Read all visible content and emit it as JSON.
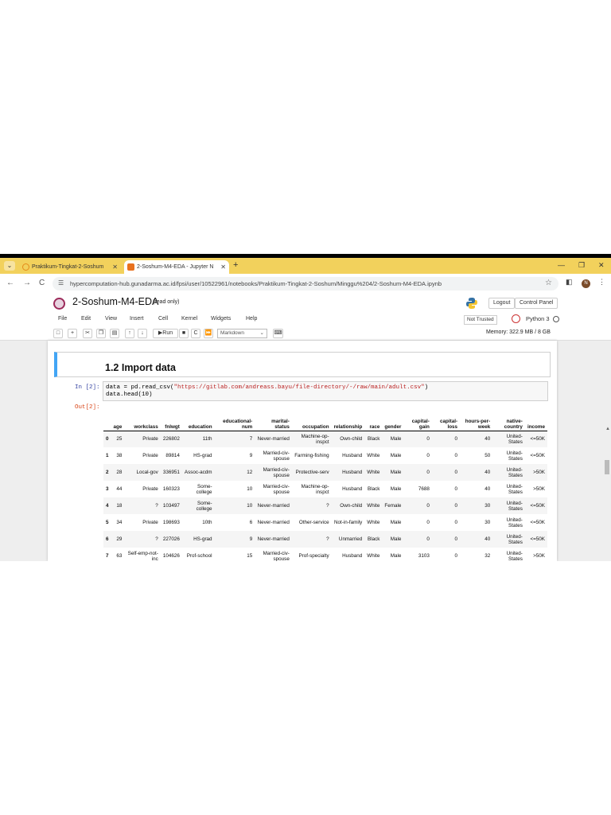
{
  "browser": {
    "tabs": [
      {
        "title": "Praktikum-Tingkat-2-Soshum",
        "active": false
      },
      {
        "title": "2-Soshum-M4-EDA - Jupyter N",
        "active": true
      }
    ],
    "url": "hypercomputation-hub.gunadarma.ac.id/fpsi/user/10522961/notebooks/Praktikum-Tingkat-2-Soshum/Minggu%204/2-Soshum-M4-EDA.ipynb",
    "avatar_letter": "N"
  },
  "jupyter": {
    "notebook_name": "2-Soshum-M4-EDA",
    "save_status": "(read only)",
    "logout_label": "Logout",
    "control_panel_label": "Control Panel",
    "menu": [
      "File",
      "Edit",
      "View",
      "Insert",
      "Cell",
      "Kernel",
      "Widgets",
      "Help"
    ],
    "trust_label": "Not Trusted",
    "kernel_name": "Python 3",
    "run_label": "Run",
    "cell_type": "Markdown",
    "memory": "Memory: 322.9 MB / 8 GB"
  },
  "cells": {
    "heading": "1.2 Import data",
    "in_prompt": "In [2]:",
    "out_prompt": "Out[2]:",
    "code_line1_pre": "data = pd.read_csv(",
    "code_line1_str": "\"https://gitlab.com/andreass.bayu/file-directory/-/raw/main/adult.csv\"",
    "code_line1_post": ")",
    "code_line2": "data.head(10)"
  },
  "table": {
    "columns": [
      "",
      "age",
      "workclass",
      "fnlwgt",
      "education",
      "educational-num",
      "marital-status",
      "occupation",
      "relationship",
      "race",
      "gender",
      "capital-gain",
      "capital-loss",
      "hours-per-week",
      "native-country",
      "income"
    ],
    "rows": [
      [
        "0",
        "25",
        "Private",
        "226802",
        "11th",
        "7",
        "Never-married",
        "Machine-op-inspct",
        "Own-child",
        "Black",
        "Male",
        "0",
        "0",
        "40",
        "United-States",
        "<=50K"
      ],
      [
        "1",
        "38",
        "Private",
        "89814",
        "HS-grad",
        "9",
        "Married-civ-spouse",
        "Farming-fishing",
        "Husband",
        "White",
        "Male",
        "0",
        "0",
        "50",
        "United-States",
        "<=50K"
      ],
      [
        "2",
        "28",
        "Local-gov",
        "336951",
        "Assoc-acdm",
        "12",
        "Married-civ-spouse",
        "Protective-serv",
        "Husband",
        "White",
        "Male",
        "0",
        "0",
        "40",
        "United-States",
        ">50K"
      ],
      [
        "3",
        "44",
        "Private",
        "160323",
        "Some-college",
        "10",
        "Married-civ-spouse",
        "Machine-op-inspct",
        "Husband",
        "Black",
        "Male",
        "7688",
        "0",
        "40",
        "United-States",
        ">50K"
      ],
      [
        "4",
        "18",
        "?",
        "103497",
        "Some-college",
        "10",
        "Never-married",
        "?",
        "Own-child",
        "White",
        "Female",
        "0",
        "0",
        "30",
        "United-States",
        "<=50K"
      ],
      [
        "5",
        "34",
        "Private",
        "198693",
        "10th",
        "6",
        "Never-married",
        "Other-service",
        "Not-in-family",
        "White",
        "Male",
        "0",
        "0",
        "30",
        "United-States",
        "<=50K"
      ],
      [
        "6",
        "29",
        "?",
        "227026",
        "HS-grad",
        "9",
        "Never-married",
        "?",
        "Unmarried",
        "Black",
        "Male",
        "0",
        "0",
        "40",
        "United-States",
        "<=50K"
      ],
      [
        "7",
        "63",
        "Self-emp-not-inc",
        "104626",
        "Prof-school",
        "15",
        "Married-civ-spouse",
        "Prof-specialty",
        "Husband",
        "White",
        "Male",
        "3103",
        "0",
        "32",
        "United-States",
        ">50K"
      ]
    ]
  }
}
